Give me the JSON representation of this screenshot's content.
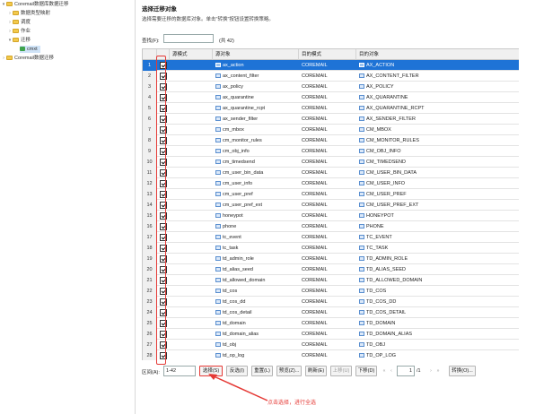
{
  "tree": {
    "root_label": "Coremail数据库数据迁移",
    "children": [
      "数据类型映射",
      "调度",
      "作业",
      "迁移"
    ],
    "selected_leaf": "cmxt",
    "second_root": "Coremail数据迁移"
  },
  "panel": {
    "title": "选择迁移对象",
    "hint": "选择需要迁移的数据库对象。单击\"转换\"按钮设置转换策略。",
    "search_label": "查找(F):",
    "search_value": "",
    "count_label": "(共 42)"
  },
  "grid": {
    "headers": [
      "源模式",
      "源对象",
      "目的模式",
      "目的对象"
    ],
    "rows": [
      {
        "n": "1",
        "src": "ax_action",
        "schema": "COREMAIL",
        "dest": "AX_ACTION"
      },
      {
        "n": "2",
        "src": "ax_content_filter",
        "schema": "COREMAIL",
        "dest": "AX_CONTENT_FILTER"
      },
      {
        "n": "3",
        "src": "ax_policy",
        "schema": "COREMAIL",
        "dest": "AX_POLICY"
      },
      {
        "n": "4",
        "src": "ax_quarantine",
        "schema": "COREMAIL",
        "dest": "AX_QUARANTINE"
      },
      {
        "n": "5",
        "src": "ax_quarantine_rcpt",
        "schema": "COREMAIL",
        "dest": "AX_QUARANTINE_RCPT"
      },
      {
        "n": "6",
        "src": "ax_sender_filter",
        "schema": "COREMAIL",
        "dest": "AX_SENDER_FILTER"
      },
      {
        "n": "7",
        "src": "cm_mbox",
        "schema": "COREMAIL",
        "dest": "CM_MBOX"
      },
      {
        "n": "8",
        "src": "cm_monitor_rules",
        "schema": "COREMAIL",
        "dest": "CM_MONITOR_RULES"
      },
      {
        "n": "9",
        "src": "cm_obj_info",
        "schema": "COREMAIL",
        "dest": "CM_OBJ_INFO"
      },
      {
        "n": "10",
        "src": "cm_timedsend",
        "schema": "COREMAIL",
        "dest": "CM_TIMEDSEND"
      },
      {
        "n": "11",
        "src": "cm_user_bin_data",
        "schema": "COREMAIL",
        "dest": "CM_USER_BIN_DATA"
      },
      {
        "n": "12",
        "src": "cm_user_info",
        "schema": "COREMAIL",
        "dest": "CM_USER_INFO"
      },
      {
        "n": "13",
        "src": "cm_user_pref",
        "schema": "COREMAIL",
        "dest": "CM_USER_PREF"
      },
      {
        "n": "14",
        "src": "cm_user_pref_ext",
        "schema": "COREMAIL",
        "dest": "CM_USER_PREF_EXT"
      },
      {
        "n": "15",
        "src": "honeypot",
        "schema": "COREMAIL",
        "dest": "HONEYPOT"
      },
      {
        "n": "16",
        "src": "phone",
        "schema": "COREMAIL",
        "dest": "PHONE"
      },
      {
        "n": "17",
        "src": "tc_event",
        "schema": "COREMAIL",
        "dest": "TC_EVENT"
      },
      {
        "n": "18",
        "src": "tc_task",
        "schema": "COREMAIL",
        "dest": "TC_TASK"
      },
      {
        "n": "19",
        "src": "td_admin_role",
        "schema": "COREMAIL",
        "dest": "TD_ADMIN_ROLE"
      },
      {
        "n": "20",
        "src": "td_alias_seed",
        "schema": "COREMAIL",
        "dest": "TD_ALIAS_SEED"
      },
      {
        "n": "21",
        "src": "td_allowed_domain",
        "schema": "COREMAIL",
        "dest": "TD_ALLOWED_DOMAIN"
      },
      {
        "n": "22",
        "src": "td_cos",
        "schema": "COREMAIL",
        "dest": "TD_COS"
      },
      {
        "n": "23",
        "src": "td_cos_dd",
        "schema": "COREMAIL",
        "dest": "TD_COS_DD"
      },
      {
        "n": "24",
        "src": "td_cos_detail",
        "schema": "COREMAIL",
        "dest": "TD_COS_DETAIL"
      },
      {
        "n": "25",
        "src": "td_domain",
        "schema": "COREMAIL",
        "dest": "TD_DOMAIN"
      },
      {
        "n": "26",
        "src": "td_domain_alias",
        "schema": "COREMAIL",
        "dest": "TD_DOMAIN_ALIAS"
      },
      {
        "n": "27",
        "src": "td_obj",
        "schema": "COREMAIL",
        "dest": "TD_OBJ"
      },
      {
        "n": "28",
        "src": "td_op_log",
        "schema": "COREMAIL",
        "dest": "TD_OP_LOG"
      }
    ]
  },
  "toolbar": {
    "range_label": "区间(A):",
    "range_value": "1-42",
    "select": "选择(S)",
    "invert": "反选(I)",
    "reset": "重置(L)",
    "preview": "预览(Z)...",
    "refresh": "刷新(E)",
    "move_up": "上移(U)",
    "move_down": "下移(D)",
    "page_value": "1",
    "page_total": "/1",
    "convert": "转换(O)..."
  },
  "annotation": "点击选择，进行全选",
  "colors": {
    "selection": "#1e73d6",
    "highlight": "#e53935"
  }
}
